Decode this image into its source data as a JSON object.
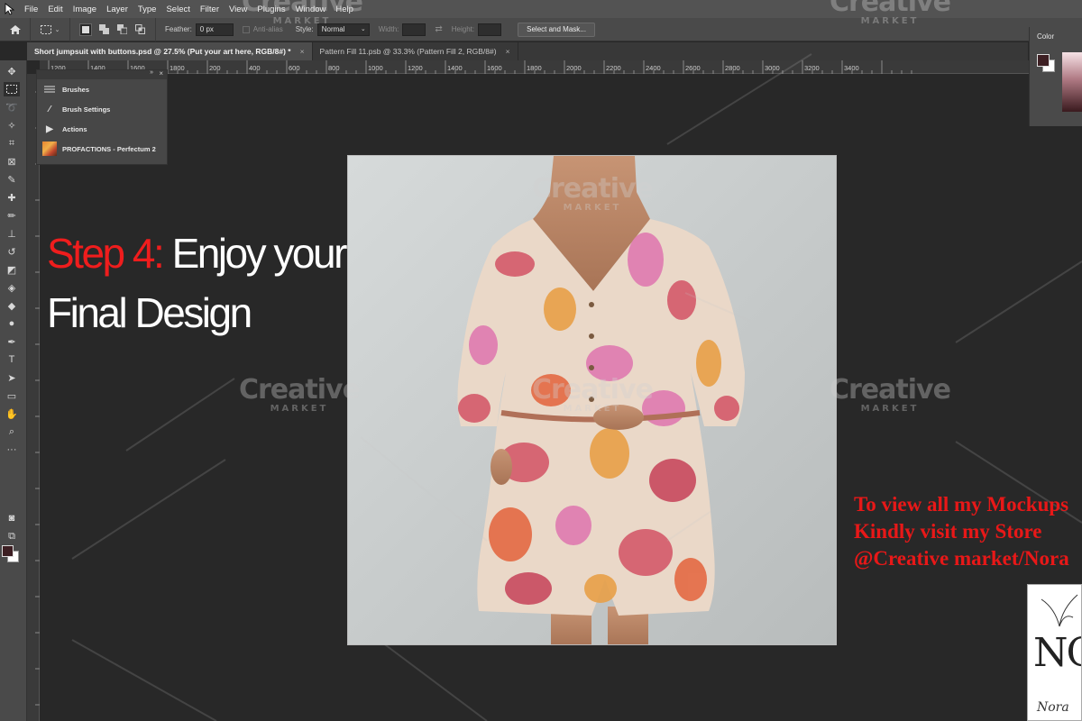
{
  "menu": [
    "File",
    "Edit",
    "Image",
    "Layer",
    "Type",
    "Select",
    "Filter",
    "View",
    "Plugins",
    "Window",
    "Help"
  ],
  "options": {
    "feather_label": "Feather:",
    "feather_value": "0 px",
    "antialias_label": "Anti-alias",
    "style_label": "Style:",
    "style_value": "Normal",
    "width_label": "Width:",
    "height_label": "Height:",
    "select_mask_label": "Select and Mask..."
  },
  "tabs": [
    {
      "label": "Short jumpsuit with buttons.psd @ 27.5% (Put your art here, RGB/8#) *",
      "close": "×"
    },
    {
      "label": "Pattern Fill 11.psb @ 33.3% (Pattern Fill 2, RGB/8#)",
      "close": "×"
    }
  ],
  "ruler_ticks": [
    "1200",
    "1400",
    "1600",
    "1800",
    "200",
    "400",
    "600",
    "800",
    "1000",
    "1200",
    "1400",
    "1600",
    "1800",
    "2000",
    "2200",
    "2400",
    "2600",
    "2800",
    "3000",
    "3200",
    "3400"
  ],
  "panel": {
    "items": [
      {
        "label": "Brushes",
        "icon": "brushes-icon"
      },
      {
        "label": "Brush Settings",
        "icon": "brush-settings-icon"
      },
      {
        "label": "Actions",
        "icon": "play-icon"
      },
      {
        "label": "PROFACTIONS - Perfectum 2",
        "icon": "plugin-thumb-icon"
      }
    ]
  },
  "color_panel": {
    "title": "Color",
    "foreground": "#3d1f23",
    "background": "#ffffff"
  },
  "overlay": {
    "step_prefix": "Step 4:",
    "step_line1": "Enjoy  your",
    "step_line2": "Final Design",
    "store_line1": "To view all my Mockups",
    "store_line2": "Kindly visit my Store",
    "store_line3": "@Creative market/Nora"
  },
  "watermark": {
    "big": "Creative",
    "small": "MARKET"
  },
  "logo": {
    "initials": "NC",
    "script": "Nora"
  },
  "colors": {
    "accent_red": "#ef1d1d",
    "store_red": "#e81818",
    "menubar": "#535353",
    "canvas_bg": "#282828"
  }
}
